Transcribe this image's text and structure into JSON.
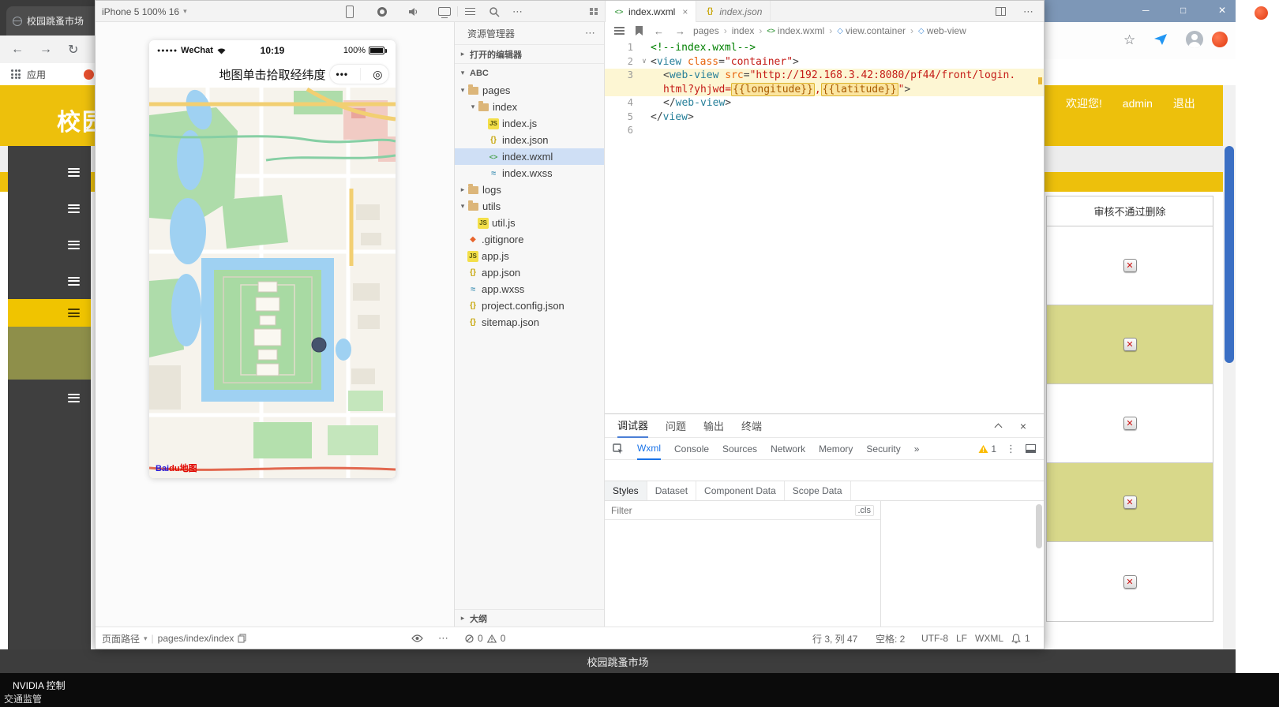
{
  "browser": {
    "tab_title": "校园跳蚤市场",
    "bookmarks": {
      "apps_label": "应用"
    },
    "window_controls": {
      "minimize": "─",
      "maximize": "□",
      "close": "✕"
    },
    "page": {
      "site_title": "校园",
      "welcome": "欢迎您!",
      "username": "admin",
      "logout": "退出",
      "table_header": "审核不通过删除",
      "rows": [
        {
          "shaded": false
        },
        {
          "shaded": true
        },
        {
          "shaded": false
        },
        {
          "shaded": true
        },
        {
          "shaded": false
        }
      ],
      "footer": "校园跳蚤市场"
    }
  },
  "taskbar": {
    "item_a": "NVIDIA 控制",
    "item_b": "交通监管"
  },
  "devtools": {
    "device_selector": "iPhone 5 100% 16",
    "editor_tabs": [
      {
        "label": "index.wxml",
        "icon": "wxml",
        "active": true,
        "closable": true
      },
      {
        "label": "index.json",
        "icon": "json",
        "active": false,
        "preview": true
      }
    ],
    "breadcrumb": [
      {
        "label": "pages"
      },
      {
        "label": "index"
      },
      {
        "label": "index.wxml",
        "icon": "wxml"
      },
      {
        "label": "view.container",
        "icon": "node"
      },
      {
        "label": "web-view",
        "icon": "node"
      }
    ],
    "simulator": {
      "carrier": "WeChat",
      "time": "10:19",
      "battery_pct": "100%",
      "nav_title": "地图单击拾取经纬度",
      "logo_bai": "Bai",
      "logo_du": "du",
      "logo_map": "地图"
    },
    "explorer": {
      "title": "资源管理器",
      "sections": {
        "open_editors": "打开的编辑器",
        "project": "ABC",
        "outline": "大纲"
      },
      "files": [
        {
          "label": "pages",
          "icon": "folder",
          "level": 1,
          "expanded": true
        },
        {
          "label": "index",
          "icon": "folder",
          "level": 2,
          "expanded": true
        },
        {
          "label": "index.js",
          "icon": "js",
          "level": 3
        },
        {
          "label": "index.json",
          "icon": "json",
          "level": 3
        },
        {
          "label": "index.wxml",
          "icon": "wxml",
          "level": 3,
          "selected": true
        },
        {
          "label": "index.wxss",
          "icon": "wxss",
          "level": 3
        },
        {
          "label": "logs",
          "icon": "folder",
          "level": 1,
          "expanded": false
        },
        {
          "label": "utils",
          "icon": "folder",
          "level": 1,
          "expanded": true
        },
        {
          "label": "util.js",
          "icon": "js",
          "level": 2
        },
        {
          "label": ".gitignore",
          "icon": "git",
          "level": 1
        },
        {
          "label": "app.js",
          "icon": "js",
          "level": 1
        },
        {
          "label": "app.json",
          "icon": "json",
          "level": 1
        },
        {
          "label": "app.wxss",
          "icon": "wxss",
          "level": 1
        },
        {
          "label": "project.config.json",
          "icon": "json",
          "level": 1
        },
        {
          "label": "sitemap.json",
          "icon": "json",
          "level": 1
        }
      ]
    },
    "code_rows": [
      {
        "num": "1",
        "tokens": [
          {
            "t": "<!--index.wxml-->",
            "c": "comment"
          }
        ]
      },
      {
        "num": "2",
        "fold": true,
        "tokens": [
          {
            "t": "<",
            "c": "punc"
          },
          {
            "t": "view",
            "c": "tag"
          },
          {
            "t": " ",
            "c": ""
          },
          {
            "t": "class",
            "c": "attr"
          },
          {
            "t": "=",
            "c": "punc"
          },
          {
            "t": "\"container\"",
            "c": "str"
          },
          {
            "t": ">",
            "c": "punc"
          }
        ]
      },
      {
        "num": "3",
        "hl": true,
        "ind": 1,
        "tokens": [
          {
            "t": "<",
            "c": "punc"
          },
          {
            "t": "web-view",
            "c": "tag"
          },
          {
            "t": " ",
            "c": ""
          },
          {
            "t": "src",
            "c": "attr"
          },
          {
            "t": "=",
            "c": "punc"
          },
          {
            "t": "\"http://192.168.3.42:8080/pf44/front/login.",
            "c": "str"
          }
        ]
      },
      {
        "num": "",
        "hl": true,
        "ind": 1,
        "tokens": [
          {
            "t": "html?yhjwd=",
            "c": "str"
          },
          {
            "t": "{{longitude}}",
            "c": "expr"
          },
          {
            "t": ",",
            "c": "str"
          },
          {
            "t": "{{latitude}}",
            "c": "expr"
          },
          {
            "t": "\"",
            "c": "str"
          },
          {
            "t": ">",
            "c": "punc"
          }
        ]
      },
      {
        "num": "4",
        "ind": 1,
        "tokens": [
          {
            "t": "</",
            "c": "punc"
          },
          {
            "t": "web-view",
            "c": "tag"
          },
          {
            "t": ">",
            "c": "punc"
          }
        ]
      },
      {
        "num": "5",
        "tokens": [
          {
            "t": "</",
            "c": "punc"
          },
          {
            "t": "view",
            "c": "tag"
          },
          {
            "t": ">",
            "c": "punc"
          }
        ]
      },
      {
        "num": "6",
        "tokens": []
      }
    ],
    "debugger": {
      "panel_tabs": [
        {
          "label": "调试器",
          "active": true
        },
        {
          "label": "问题"
        },
        {
          "label": "输出"
        },
        {
          "label": "终端"
        }
      ],
      "cdt_tabs": [
        {
          "label": "Wxml",
          "active": true
        },
        {
          "label": "Console"
        },
        {
          "label": "Sources"
        },
        {
          "label": "Network"
        },
        {
          "label": "Memory"
        },
        {
          "label": "Security"
        }
      ],
      "overflow": "»",
      "warning_count": "1",
      "style_tabs": [
        {
          "label": "Styles",
          "active": true
        },
        {
          "label": "Dataset"
        },
        {
          "label": "Component Data"
        },
        {
          "label": "Scope Data"
        }
      ],
      "filter_placeholder": "Filter",
      "cls_toggle": ".cls"
    },
    "statusbar": {
      "path_label": "页面路径",
      "path_value": "pages/index/index",
      "error_count": "0",
      "warn_count": "0",
      "cursor": "行 3, 列 47",
      "indent": "空格: 2",
      "encoding": "UTF-8",
      "eol": "LF",
      "language": "WXML",
      "notif_count": "1"
    }
  }
}
